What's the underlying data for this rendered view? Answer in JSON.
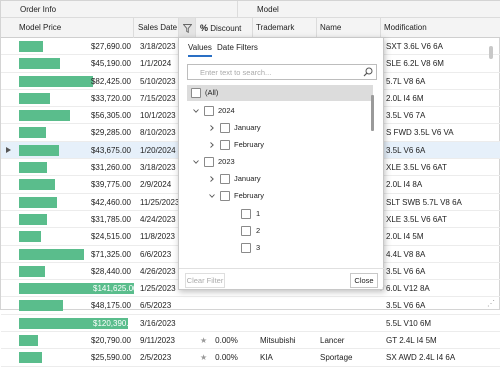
{
  "bands": {
    "order_info": "Order Info",
    "model": "Model"
  },
  "columns": {
    "model_price": "Model Price",
    "sales_date": "Sales Date",
    "discount_symbol": "%",
    "discount": "Discount",
    "trademark": "Trademark",
    "name": "Name",
    "modification": "Modification"
  },
  "rows": [
    {
      "price": "$27,690.00",
      "price_fraction": 0.19,
      "date": "3/18/2023",
      "modification": "SXT 3.6L V6 6A"
    },
    {
      "price": "$45,190.00",
      "price_fraction": 0.32,
      "date": "1/1/2024",
      "modification": "SLE 6.2L V8 6M"
    },
    {
      "price": "$82,425.00",
      "price_fraction": 0.58,
      "date": "5/10/2023",
      "modification": "5.7L V8 6A"
    },
    {
      "price": "$33,720.00",
      "price_fraction": 0.24,
      "date": "7/15/2023",
      "modification": "2.0L I4 6M"
    },
    {
      "price": "$56,305.00",
      "price_fraction": 0.4,
      "date": "10/1/2023",
      "modification": "3.5L V6 7A"
    },
    {
      "price": "$29,285.00",
      "price_fraction": 0.21,
      "date": "8/10/2023",
      "modification": "S FWD 3.5L V6 VA"
    },
    {
      "price": "$43,675.00",
      "price_fraction": 0.31,
      "date": "1/20/2024",
      "modification": "3.5L V6 6A"
    },
    {
      "price": "$31,260.00",
      "price_fraction": 0.22,
      "date": "3/18/2023",
      "modification": "XLE 3.5L V6 6AT"
    },
    {
      "price": "$39,775.00",
      "price_fraction": 0.28,
      "date": "2/9/2024",
      "modification": "2.0L I4 8A"
    },
    {
      "price": "$42,460.00",
      "price_fraction": 0.3,
      "date": "11/25/2023",
      "modification": "SLT SWB 5.7L V8 6A"
    },
    {
      "price": "$31,785.00",
      "price_fraction": 0.22,
      "date": "4/24/2023",
      "modification": "XLE 3.5L V6 6AT"
    },
    {
      "price": "$24,515.00",
      "price_fraction": 0.17,
      "date": "11/8/2023",
      "modification": "2.0L I4 5M"
    },
    {
      "price": "$71,325.00",
      "price_fraction": 0.51,
      "date": "6/6/2023",
      "modification": "4.4L V8 8A"
    },
    {
      "price": "$28,440.00",
      "price_fraction": 0.2,
      "date": "4/26/2023",
      "modification": "3.5L V6 6A"
    },
    {
      "price": "$141,625.00",
      "price_fraction": 1.0,
      "date": "1/25/2023",
      "modification": "6.0L V12 8A"
    },
    {
      "price": "$48,175.00",
      "price_fraction": 0.34,
      "date": "6/5/2023",
      "modification": "3.5L V6 6A"
    },
    {
      "price": "$120,390.00",
      "price_fraction": 0.85,
      "date": "3/16/2023",
      "modification": "5.5L V10 6M"
    },
    {
      "price": "$20,790.00",
      "price_fraction": 0.15,
      "date": "9/11/2023",
      "discount": "0.00%",
      "trademark": "Mitsubishi",
      "name": "Lancer",
      "modification": "GT 2.4L I4 5M"
    },
    {
      "price": "$25,590.00",
      "price_fraction": 0.18,
      "date": "2/5/2023",
      "discount": "0.00%",
      "trademark": "KIA",
      "name": "Sportage",
      "modification": "SX AWD 2.4L I4 6A"
    }
  ],
  "filter_popup": {
    "tabs": [
      "Values",
      "Date Filters"
    ],
    "search_placeholder": "Enter text to search...",
    "tree": {
      "all": "(All)",
      "y2024": "2024",
      "jan24": "January",
      "feb24": "February",
      "y2023": "2023",
      "jan23": "January",
      "feb23": "February",
      "d1": "1",
      "d2": "2",
      "d3": "3"
    },
    "clear_label": "Clear Filter",
    "close_label": "Close"
  },
  "colors": {
    "bar": "#5abd8c",
    "accent": "#2a6fc4"
  },
  "icons": {
    "filter": "funnel-icon",
    "search": "search-icon",
    "star": "star-icon"
  }
}
